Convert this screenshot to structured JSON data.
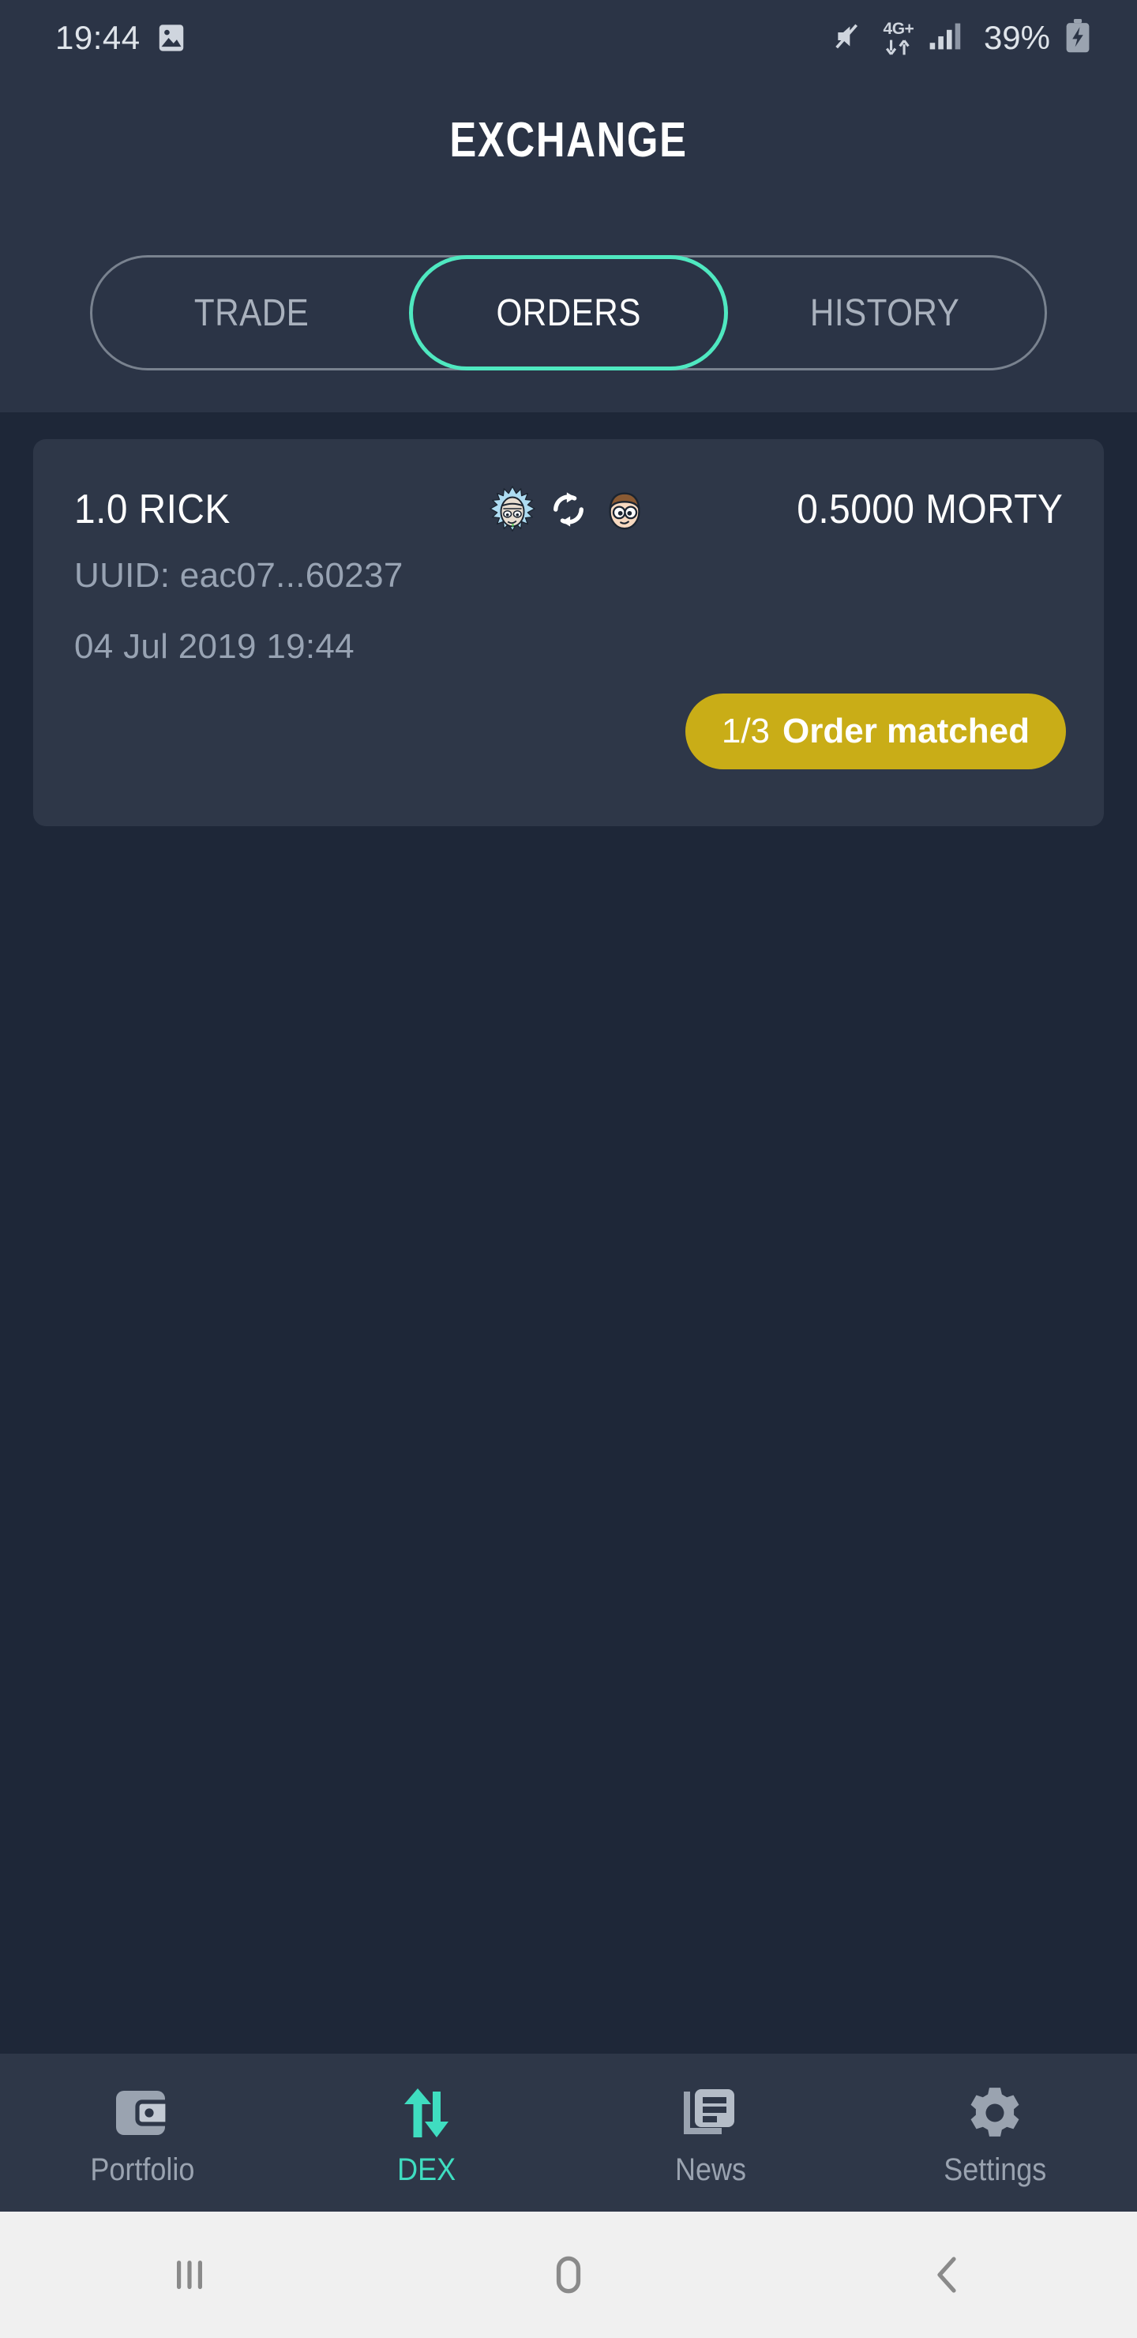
{
  "status_bar": {
    "time": "19:44",
    "gallery_icon": "gallery-icon",
    "mute_icon": "speaker-muted-icon",
    "network_label": "4G+",
    "data_arrows_icon": "data-transfer-icon",
    "signal_icon": "signal-bars-icon",
    "battery_percent": "39%",
    "battery_icon": "battery-charging-icon"
  },
  "header": {
    "title": "EXCHANGE"
  },
  "tabs": [
    {
      "label": "TRADE",
      "active": false
    },
    {
      "label": "ORDERS",
      "active": true
    },
    {
      "label": "HISTORY",
      "active": false
    }
  ],
  "order": {
    "base_amount": "1.0 RICK",
    "rel_amount": "0.5000 MORTY",
    "base_coin_icon": "rick-coin-icon",
    "swap_icon": "swap-arrows-icon",
    "rel_coin_icon": "morty-coin-icon",
    "uuid": "UUID: eac07...60237",
    "date": "04 Jul 2019 19:44",
    "status_fraction": "1/3",
    "status_text": "Order matched",
    "status_color": "#c9ad17"
  },
  "bottom_nav": [
    {
      "label": "Portfolio",
      "icon": "wallet-icon",
      "active": false
    },
    {
      "label": "DEX",
      "icon": "swap-vertical-icon",
      "active": true
    },
    {
      "label": "News",
      "icon": "news-article-icon",
      "active": false
    },
    {
      "label": "Settings",
      "icon": "gear-icon",
      "active": false
    }
  ],
  "android_nav": [
    {
      "icon": "recents-icon"
    },
    {
      "icon": "home-icon"
    },
    {
      "icon": "back-icon"
    }
  ],
  "colors": {
    "page_bg": "#1e2738",
    "header_bg": "#2b3446",
    "card_bg": "#2e3748",
    "accent": "#4fe8c0",
    "muted_text": "#98a3b3"
  }
}
